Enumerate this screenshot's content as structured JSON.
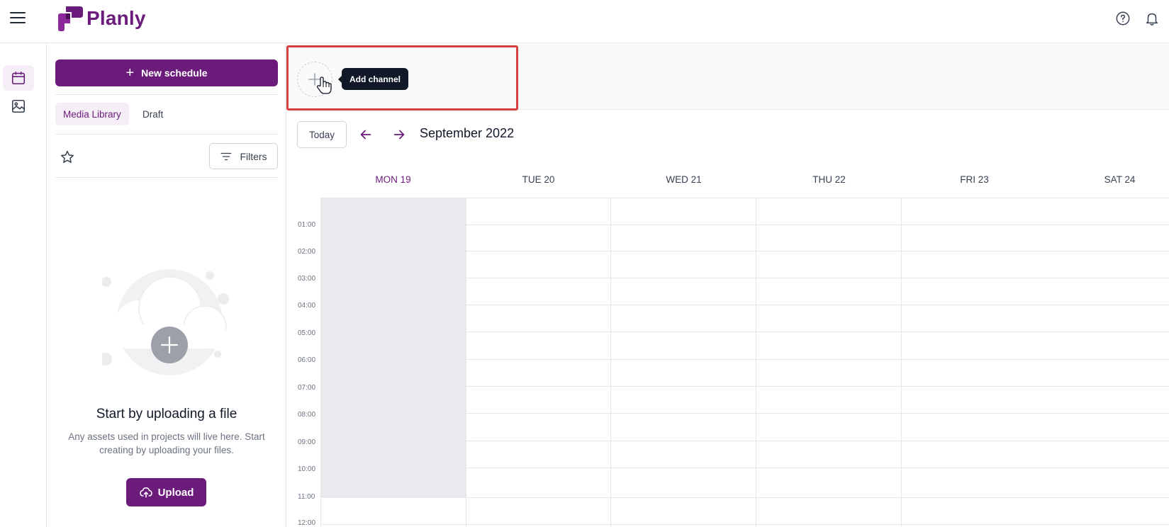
{
  "app": {
    "name": "Planly",
    "brand_color": "#6b1b7a"
  },
  "header": {
    "menu_icon": "hamburger-icon",
    "help_icon": "help-circle-icon",
    "notifications_icon": "bell-icon"
  },
  "rail": {
    "items": [
      {
        "icon": "calendar-icon",
        "active": true
      },
      {
        "icon": "image-icon",
        "active": false
      }
    ]
  },
  "panel": {
    "new_schedule_label": "New schedule",
    "tabs": [
      {
        "label": "Media Library",
        "active": true
      },
      {
        "label": "Draft",
        "active": false
      }
    ],
    "filters_label": "Filters",
    "empty_title": "Start by uploading a file",
    "empty_description": "Any assets used in projects will live here. Start creating by uploading your files.",
    "upload_label": "Upload"
  },
  "channel_bar": {
    "add_channel_tooltip": "Add channel"
  },
  "calendar": {
    "today_label": "Today",
    "month_label": "September 2022",
    "days": [
      {
        "label": "MON 19",
        "today": true
      },
      {
        "label": "TUE 20",
        "today": false
      },
      {
        "label": "WED 21",
        "today": false
      },
      {
        "label": "THU 22",
        "today": false
      },
      {
        "label": "FRI 23",
        "today": false
      },
      {
        "label": "SAT 24",
        "today": false
      }
    ],
    "times": [
      "01:00",
      "02:00",
      "03:00",
      "04:00",
      "05:00",
      "06:00",
      "07:00",
      "08:00",
      "09:00",
      "10:00",
      "11:00",
      "12:00"
    ]
  }
}
